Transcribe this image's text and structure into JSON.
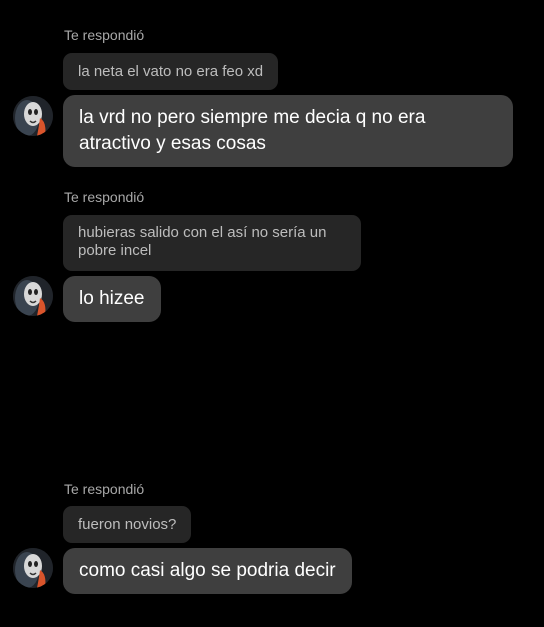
{
  "messages": [
    {
      "reply_label": "Te respondió",
      "quoted": "la neta el vato no era feo xd",
      "text": "la vrd no pero siempre me decia q no era atractivo y esas cosas"
    },
    {
      "reply_label": "Te respondió",
      "quoted": "hubieras salido con el así no sería un pobre incel",
      "text": "lo hizee"
    },
    {
      "reply_label": "Te respondió",
      "quoted": "fueron novios?",
      "text": "como casi algo se podria decir"
    }
  ],
  "colors": {
    "background": "#000000",
    "quote_bubble": "#262626",
    "message_bubble": "#3f3f3f",
    "label": "#a8a8a8"
  },
  "icons": {
    "avatar": "avatar-icon"
  }
}
